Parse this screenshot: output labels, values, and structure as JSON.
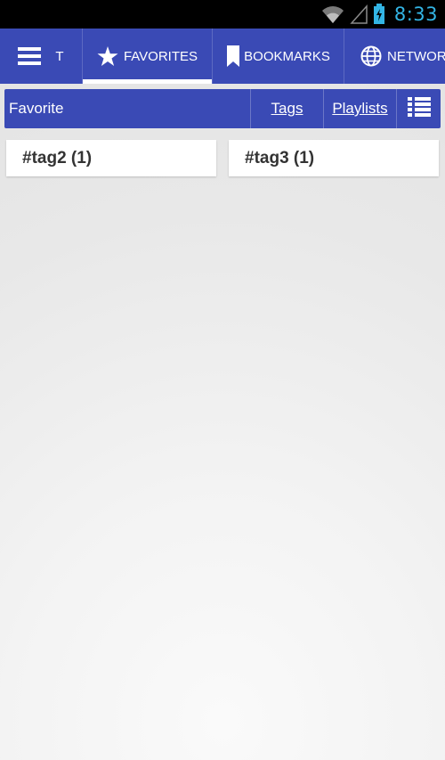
{
  "status_bar": {
    "time": "8:33",
    "icons": [
      "wifi-icon",
      "cell-signal-icon",
      "battery-charging-icon"
    ],
    "time_color": "#33b5e5"
  },
  "tabs": [
    {
      "label": "T",
      "icon": "menu-icon",
      "active": false
    },
    {
      "label": "FAVORITES",
      "icon": "star-icon",
      "active": true
    },
    {
      "label": "BOOKMARKS",
      "icon": "bookmark-icon",
      "active": false
    },
    {
      "label": "NETWORK",
      "icon": "globe-icon",
      "active": false
    }
  ],
  "sub_bar": {
    "title": "Favorite",
    "tags_link": "Tags",
    "playlists_link": "Playlists",
    "menu_icon": "list-view-icon"
  },
  "tag_cards": [
    {
      "label": "#tag2 (1)"
    },
    {
      "label": "#tag3 (1)"
    }
  ],
  "colors": {
    "accent": "#3a4ab5",
    "status_bar": "#000000",
    "background": "#e8e8e8"
  }
}
